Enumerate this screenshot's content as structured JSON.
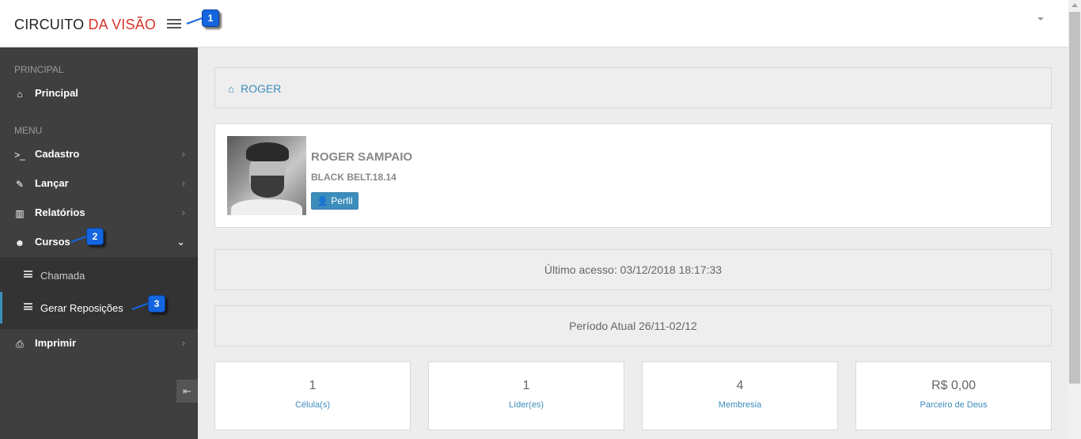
{
  "header": {
    "logo_part1": "CIRCUITO",
    "logo_part2": "DA VISÃO"
  },
  "sidebar": {
    "section_principal": "PRINCIPAL",
    "principal_item": "Principal",
    "section_menu": "MENU",
    "items": [
      {
        "label": "Cadastro"
      },
      {
        "label": "Lançar"
      },
      {
        "label": "Relatórios"
      },
      {
        "label": "Cursos"
      },
      {
        "label": "Imprimir"
      }
    ],
    "submenu": [
      {
        "label": "Chamada"
      },
      {
        "label": "Gerar Reposições"
      }
    ]
  },
  "breadcrumb": {
    "text": "ROGER"
  },
  "profile": {
    "name": "ROGER SAMPAIO",
    "role": "BLACK BELT.18.14",
    "button": "Perfil"
  },
  "info": {
    "last_access": "Último acesso: 03/12/2018 18:17:33",
    "period": "Período Atual 26/11-02/12"
  },
  "stats": [
    {
      "value": "1",
      "label": "Célula(s)"
    },
    {
      "value": "1",
      "label": "Líder(es)"
    },
    {
      "value": "4",
      "label": "Membresia"
    },
    {
      "value": "R$ 0,00",
      "label": "Parceiro de Deus"
    }
  ],
  "callouts": [
    "1",
    "2",
    "3"
  ],
  "colors": {
    "accent": "#3c8dbc",
    "callout": "#1565e0",
    "brand_red": "#d9342b",
    "sidebar": "#3f3f3f"
  }
}
